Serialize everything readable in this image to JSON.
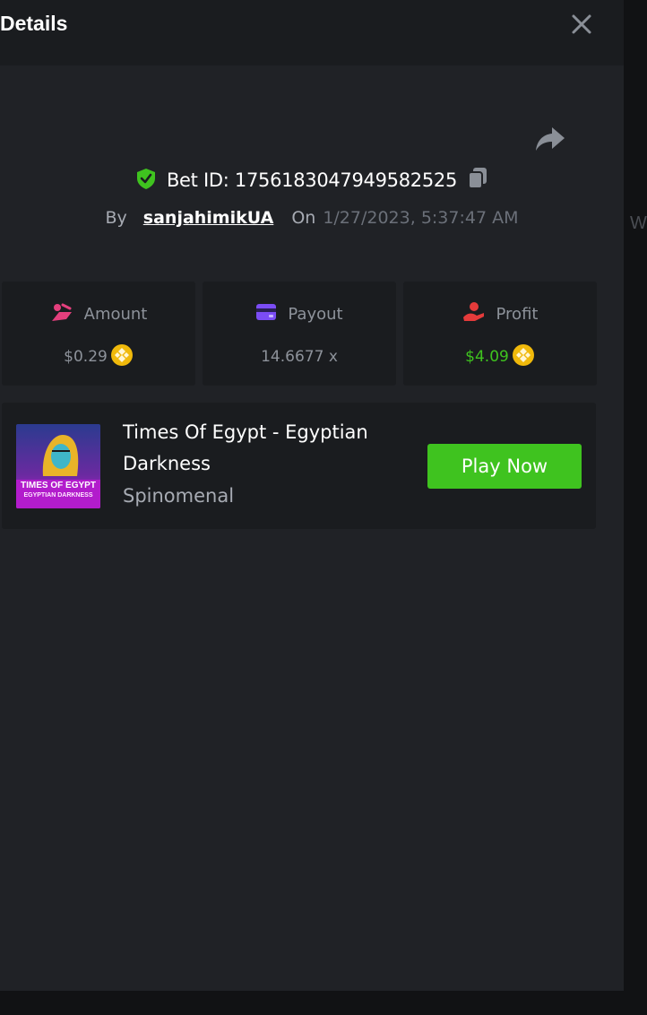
{
  "header": {
    "title": "Details"
  },
  "bet": {
    "id_label": "Bet ID: 1756183047949582525",
    "by_label": "By",
    "username": "sanjahimikUA",
    "on_label": "On",
    "datetime": "1/27/2023, 5:37:47 AM"
  },
  "backdrop": {
    "text": "W"
  },
  "stats": {
    "amount": {
      "label": "Amount",
      "value": "$0.29",
      "icon": "hand-coins-icon",
      "color": "#e43f7d"
    },
    "payout": {
      "label": "Payout",
      "value": "14.6677 x",
      "icon": "wallet-card-icon",
      "color": "#7b4cf5"
    },
    "profit": {
      "label": "Profit",
      "value": "$4.09",
      "icon": "hand-give-icon",
      "color": "#e53b3b",
      "value_color": "#3fc31f"
    }
  },
  "game": {
    "title": "Times Of Egypt - Egyptian Darkness",
    "provider": "Spinomenal",
    "play_label": "Play Now",
    "thumb_line1": "TIMES OF EGYPT",
    "thumb_line2": "EGYPTIAN DARKNESS"
  },
  "colors": {
    "accent_green": "#3fc31f",
    "modal_bg": "#202226",
    "card_bg": "#1a1c1f",
    "coin": "#f0b90b"
  }
}
